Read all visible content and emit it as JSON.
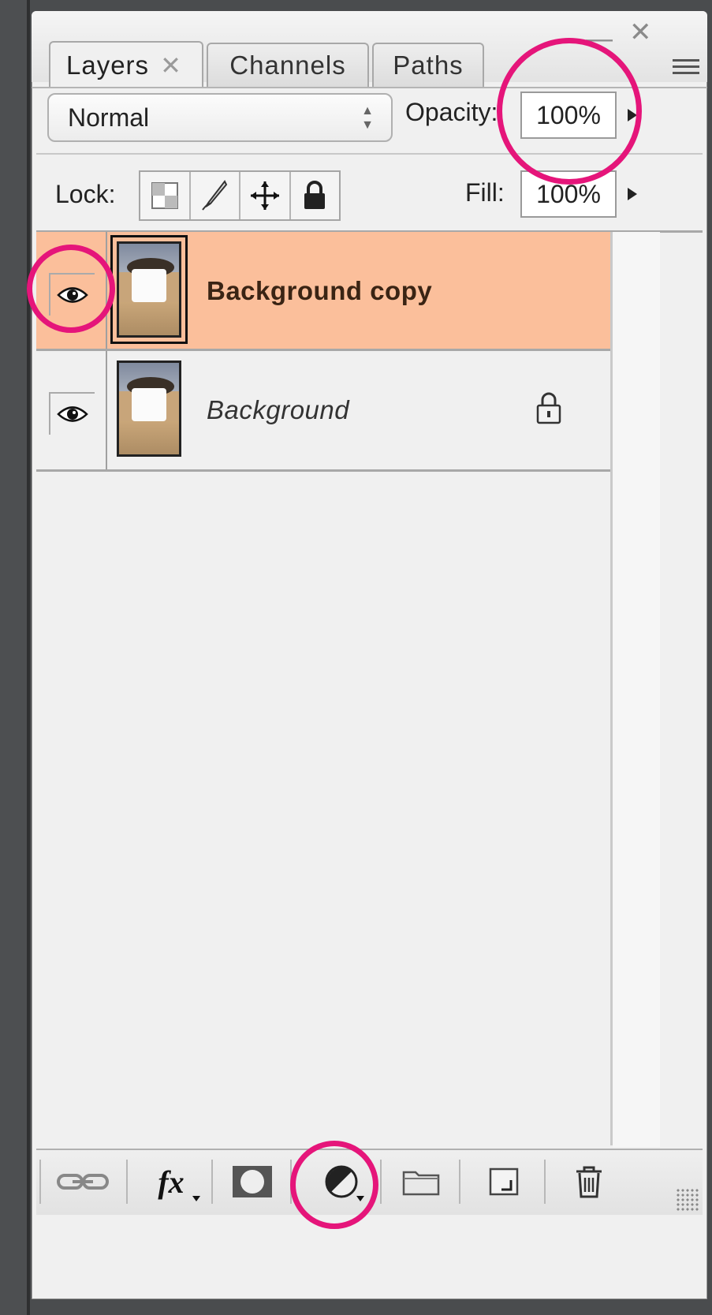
{
  "panel": {
    "tabs": [
      {
        "label": "Layers",
        "active": true,
        "closable": true
      },
      {
        "label": "Channels",
        "active": false
      },
      {
        "label": "Paths",
        "active": false
      }
    ],
    "window_controls": {
      "minimize_icon": "minimize-icon",
      "close_icon": "close-icon"
    },
    "menu_icon": "panel-menu-icon"
  },
  "blend_mode": {
    "value": "Normal"
  },
  "opacity": {
    "label": "Opacity:",
    "value": "100%"
  },
  "lock": {
    "label": "Lock:",
    "buttons": [
      "lock-transparent-pixels-icon",
      "lock-image-pixels-icon",
      "lock-position-icon",
      "lock-all-icon"
    ]
  },
  "fill": {
    "label": "Fill:",
    "value": "100%"
  },
  "layers": [
    {
      "name": "Background copy",
      "visible": true,
      "selected": true,
      "locked": false
    },
    {
      "name": "Background",
      "visible": true,
      "selected": false,
      "locked": true
    }
  ],
  "bottom_toolbar": [
    "link-layers-icon",
    "layer-style-fx-icon",
    "add-layer-mask-icon",
    "new-adjustment-layer-icon",
    "new-group-icon",
    "new-layer-icon",
    "delete-layer-icon"
  ],
  "colors": {
    "selected_row": "#fbbf9b",
    "highlight_circle": "#e5157a",
    "panel_bg": "#f0f0f0",
    "frame": "#4a4c4e"
  }
}
